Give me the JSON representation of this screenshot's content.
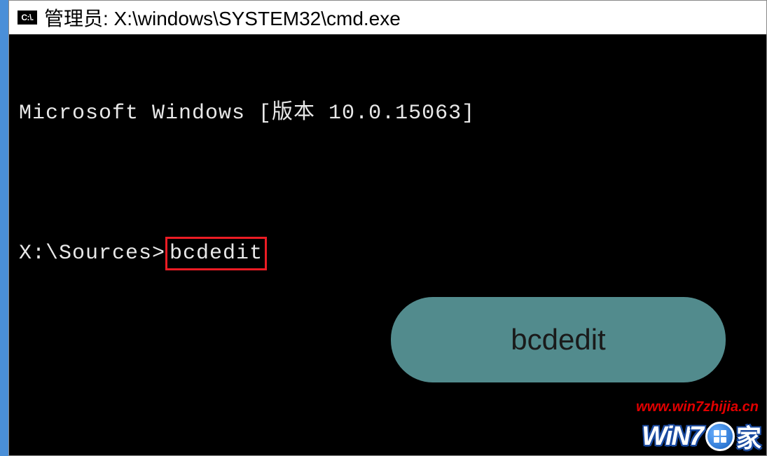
{
  "titlebar": {
    "icon_text": "C:\\.",
    "title": "管理员: X:\\windows\\SYSTEM32\\cmd.exe"
  },
  "terminal": {
    "line1": "Microsoft Windows [版本 10.0.15063]",
    "blank": "",
    "prompt": "X:\\Sources>",
    "command": "bcdedit"
  },
  "callout": {
    "text": "bcdedit"
  },
  "watermark": {
    "url": "www.win7zhijia.cn",
    "logo_win": "WiN",
    "logo_7": "7",
    "logo_jia": "家"
  }
}
